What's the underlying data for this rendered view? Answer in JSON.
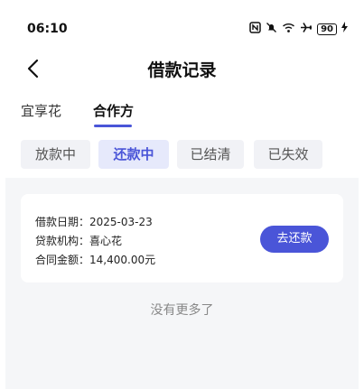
{
  "status_bar": {
    "time": "06:10",
    "battery": "90",
    "icons": [
      "nfc-icon",
      "mute-icon",
      "wifi-icon",
      "airplane-icon",
      "battery-icon",
      "charging-icon"
    ]
  },
  "nav": {
    "title": "借款记录"
  },
  "tabs": [
    {
      "label": "宜享花",
      "selected": false
    },
    {
      "label": "合作方",
      "selected": true
    }
  ],
  "filters": [
    {
      "label": "放款中",
      "selected": false
    },
    {
      "label": "还款中",
      "selected": true
    },
    {
      "label": "已结清",
      "selected": false
    },
    {
      "label": "已失效",
      "selected": false
    }
  ],
  "loan_card": {
    "date_label": "借款日期：",
    "date": "2025-03-23",
    "institution_label": "贷款机构：",
    "institution": "喜心花",
    "amount_label": "合同金额：",
    "amount": "14,400.00元",
    "action_label": "去还款"
  },
  "footer_text": "没有更多了",
  "colors": {
    "accent": "#4a55d8",
    "chip_selected_bg": "#e6e9fb",
    "chip_bg": "#f1f2f6",
    "content_bg": "#f5f6f8"
  }
}
